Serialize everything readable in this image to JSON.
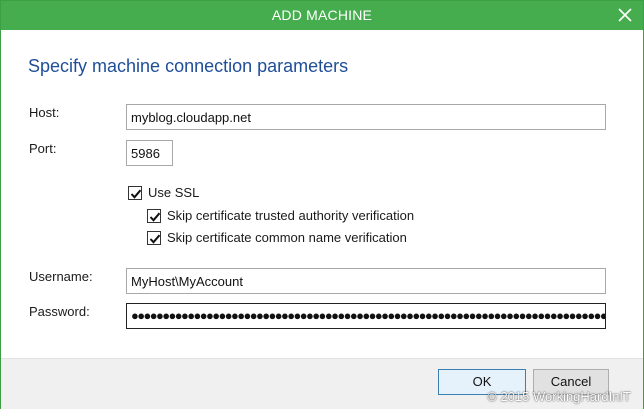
{
  "window": {
    "title": "ADD MACHINE",
    "accent": "#46ad4e"
  },
  "heading": "Specify machine connection parameters",
  "form": {
    "host_label": "Host:",
    "host_value": "myblog.cloudapp.net",
    "port_label": "Port:",
    "port_value": "5986",
    "use_ssl_label": "Use SSL",
    "use_ssl_checked": true,
    "skip_ca_label": "Skip certificate trusted authority verification",
    "skip_ca_checked": true,
    "skip_cn_label": "Skip certificate common name verification",
    "skip_cn_checked": true,
    "username_label": "Username:",
    "username_value": "MyHost\\MyAccount",
    "password_label": "Password:",
    "password_value": "●●●●●●●●●●●●●●●●●●●●●●●●●●●●●●●●●●●●●●●●●●●●●●●●●●●●●●●●●●●●●●●●●●●●●●●●●●●●●●●●●●●●●●●●"
  },
  "buttons": {
    "ok": "OK",
    "cancel": "Cancel"
  },
  "watermark": "© 2015 WorkingHardInIT",
  "icons": {
    "close": "close-icon",
    "check": "checkmark-icon"
  }
}
